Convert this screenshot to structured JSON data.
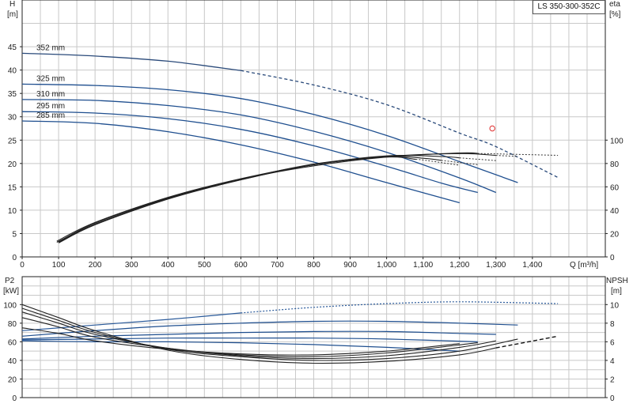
{
  "title_box": "LS 350-300-352C",
  "chart_data": [
    {
      "type": "line",
      "name": "head-efficiency",
      "xlabel": "Q [m³/h]",
      "xlim": [
        0,
        1600
      ],
      "x_ticks": [
        0,
        100,
        200,
        300,
        400,
        500,
        600,
        700,
        800,
        900,
        1000,
        1100,
        1200,
        1300,
        1400
      ],
      "x_tick_labels": [
        "0",
        "100",
        "200",
        "300",
        "400",
        "500",
        "600",
        "700",
        "800",
        "900",
        "1,000",
        "1,100",
        "1,200",
        "1,300",
        "1,400"
      ],
      "ylabel_left": [
        "H",
        "[m]"
      ],
      "ylim_left": [
        0,
        55
      ],
      "y_ticks_left": [
        0,
        5,
        10,
        15,
        20,
        25,
        30,
        35,
        40,
        45
      ],
      "ylabel_right": [
        "eta",
        "[%]"
      ],
      "ylim_right": [
        0,
        220
      ],
      "y_ticks_right": [
        0,
        20,
        40,
        60,
        80,
        100
      ],
      "grid": true,
      "marker": {
        "x": 1290,
        "y": 27.5,
        "color": "#e03030"
      },
      "head_curves": [
        {
          "label": "352 mm",
          "color": "#2a4a7a",
          "solid": [
            [
              0,
              43.6
            ],
            [
              200,
              43.0
            ],
            [
              400,
              41.9
            ],
            [
              600,
              39.9
            ]
          ],
          "dashed": [
            [
              600,
              39.9
            ],
            [
              800,
              36.8
            ],
            [
              1000,
              32.6
            ],
            [
              1200,
              26.5
            ],
            [
              1300,
              23.6
            ],
            [
              1470,
              17.0
            ]
          ]
        },
        {
          "label": "325 mm",
          "color": "#1f4f8f",
          "solid": [
            [
              0,
              37.0
            ],
            [
              200,
              36.7
            ],
            [
              400,
              35.8
            ],
            [
              600,
              33.9
            ],
            [
              800,
              30.5
            ],
            [
              1000,
              26.0
            ],
            [
              1200,
              20.4
            ],
            [
              1360,
              15.9
            ]
          ],
          "dashed": []
        },
        {
          "label": "310 mm",
          "color": "#1f4f8f",
          "solid": [
            [
              0,
              33.7
            ],
            [
              200,
              33.5
            ],
            [
              400,
              32.4
            ],
            [
              600,
              30.4
            ],
            [
              800,
              26.9
            ],
            [
              1000,
              22.4
            ],
            [
              1200,
              16.9
            ],
            [
              1300,
              13.8
            ]
          ],
          "dashed": []
        },
        {
          "label": "295 mm",
          "color": "#1f4f8f",
          "solid": [
            [
              0,
              31.1
            ],
            [
              200,
              30.8
            ],
            [
              400,
              29.6
            ],
            [
              600,
              27.3
            ],
            [
              800,
              23.8
            ],
            [
              1000,
              19.4
            ],
            [
              1150,
              15.8
            ],
            [
              1250,
              13.8
            ]
          ],
          "dashed": []
        },
        {
          "label": "285 mm",
          "color": "#1f4f8f",
          "solid": [
            [
              0,
              29.1
            ],
            [
              200,
              28.6
            ],
            [
              400,
              26.8
            ],
            [
              600,
              24.0
            ],
            [
              800,
              20.3
            ],
            [
              1000,
              15.9
            ],
            [
              1200,
              11.6
            ]
          ],
          "dashed": []
        }
      ],
      "eta_curves": [
        {
          "points": [
            [
              95,
              12.5
            ],
            [
              200,
              28.0
            ],
            [
              400,
              50.0
            ],
            [
              600,
              66.5
            ],
            [
              800,
              78.0
            ],
            [
              1000,
              85.5
            ],
            [
              1200,
              89.0
            ],
            [
              1470,
              87.0
            ]
          ],
          "dashed_from": 1250
        },
        {
          "points": [
            [
              95,
              13.5
            ],
            [
              200,
              29.5
            ],
            [
              400,
              51.0
            ],
            [
              600,
              67.0
            ],
            [
              800,
              79.0
            ],
            [
              1000,
              86.0
            ],
            [
              1200,
              88.5
            ],
            [
              1360,
              86.0
            ]
          ],
          "dashed_from": 1300
        },
        {
          "points": [
            [
              100,
              12.5
            ],
            [
              200,
              28.0
            ],
            [
              400,
              50.0
            ],
            [
              600,
              66.0
            ],
            [
              800,
              79.0
            ],
            [
              1000,
              86.5
            ],
            [
              1150,
              86.0
            ],
            [
              1300,
              82.5
            ]
          ],
          "dashed_from": 1200
        },
        {
          "points": [
            [
              100,
              13.0
            ],
            [
              200,
              29.0
            ],
            [
              400,
              50.5
            ],
            [
              600,
              66.5
            ],
            [
              800,
              79.5
            ],
            [
              1000,
              86.0
            ],
            [
              1100,
              84.5
            ],
            [
              1250,
              79.0
            ]
          ],
          "dashed_from": 1150
        },
        {
          "points": [
            [
              100,
              12.0
            ],
            [
              200,
              27.5
            ],
            [
              400,
              49.5
            ],
            [
              600,
              66.0
            ],
            [
              800,
              79.0
            ],
            [
              1000,
              85.5
            ],
            [
              1100,
              83.0
            ],
            [
              1200,
              78.5
            ]
          ],
          "dashed_from": 1080
        }
      ]
    },
    {
      "type": "line",
      "name": "power-npsh",
      "xlim": [
        0,
        1600
      ],
      "ylabel_left": [
        "P2",
        "[kW]"
      ],
      "ylim_left": [
        0,
        130
      ],
      "y_ticks_left": [
        0,
        20,
        40,
        60,
        80,
        100
      ],
      "ylabel_right": [
        "NPSH",
        "[m]"
      ],
      "ylim_right": [
        0,
        13
      ],
      "y_ticks_right": [
        0,
        2,
        4,
        6,
        8,
        10
      ],
      "grid": true,
      "power_curves": [
        {
          "color": "#2a5a9a",
          "points": [
            [
              0,
              72
            ],
            [
              200,
              78
            ],
            [
              400,
              84
            ],
            [
              600,
              91
            ],
            [
              800,
              97
            ],
            [
              1000,
              101
            ],
            [
              1200,
              103
            ],
            [
              1470,
              101
            ]
          ],
          "dashed_from": 600
        },
        {
          "color": "#1f4f8f",
          "points": [
            [
              0,
              66
            ],
            [
              200,
              72
            ],
            [
              400,
              77
            ],
            [
              600,
              80
            ],
            [
              800,
              82
            ],
            [
              1000,
              82
            ],
            [
              1200,
              80
            ],
            [
              1360,
              78
            ]
          ],
          "dashed_from": null
        },
        {
          "color": "#1f4f8f",
          "points": [
            [
              0,
              63
            ],
            [
              200,
              66
            ],
            [
              400,
              68
            ],
            [
              600,
              70
            ],
            [
              800,
              71
            ],
            [
              1000,
              71
            ],
            [
              1200,
              69
            ],
            [
              1300,
              68
            ]
          ],
          "dashed_from": null
        },
        {
          "color": "#1f4f8f",
          "points": [
            [
              0,
              62
            ],
            [
              200,
              63
            ],
            [
              400,
              64
            ],
            [
              600,
              64
            ],
            [
              800,
              64
            ],
            [
              1000,
              63
            ],
            [
              1250,
              60
            ]
          ],
          "dashed_from": null
        },
        {
          "color": "#1f4f8f",
          "points": [
            [
              0,
              61
            ],
            [
              200,
              60
            ],
            [
              400,
              60
            ],
            [
              600,
              59
            ],
            [
              800,
              57
            ],
            [
              1000,
              54
            ],
            [
              1200,
              50
            ]
          ],
          "dashed_from": null
        }
      ],
      "npsh_curves": [
        {
          "points": [
            [
              0,
              10.0
            ],
            [
              100,
              8.6
            ],
            [
              200,
              7.2
            ],
            [
              400,
              5.1
            ],
            [
              600,
              4.1
            ],
            [
              800,
              3.7
            ],
            [
              1000,
              3.9
            ],
            [
              1200,
              4.6
            ],
            [
              1470,
              6.6
            ]
          ],
          "dashed_from": 1300
        },
        {
          "points": [
            [
              0,
              9.6
            ],
            [
              100,
              8.3
            ],
            [
              200,
              7.0
            ],
            [
              400,
              5.2
            ],
            [
              600,
              4.4
            ],
            [
              800,
              4.0
            ],
            [
              1000,
              4.2
            ],
            [
              1200,
              5.0
            ],
            [
              1360,
              6.3
            ]
          ],
          "dashed_from": null
        },
        {
          "points": [
            [
              0,
              9.2
            ],
            [
              100,
              8.0
            ],
            [
              200,
              6.8
            ],
            [
              400,
              5.3
            ],
            [
              600,
              4.5
            ],
            [
              800,
              4.2
            ],
            [
              1000,
              4.5
            ],
            [
              1200,
              5.4
            ],
            [
              1300,
              6.1
            ]
          ],
          "dashed_from": null
        },
        {
          "points": [
            [
              0,
              8.6
            ],
            [
              100,
              7.6
            ],
            [
              200,
              6.5
            ],
            [
              400,
              5.3
            ],
            [
              600,
              4.6
            ],
            [
              800,
              4.4
            ],
            [
              1000,
              4.8
            ],
            [
              1250,
              5.9
            ]
          ],
          "dashed_from": null
        },
        {
          "points": [
            [
              0,
              7.5
            ],
            [
              100,
              6.9
            ],
            [
              200,
              6.1
            ],
            [
              400,
              5.2
            ],
            [
              600,
              4.7
            ],
            [
              800,
              4.6
            ],
            [
              1000,
              5.0
            ],
            [
              1200,
              5.8
            ]
          ],
          "dashed_from": null
        }
      ]
    }
  ]
}
